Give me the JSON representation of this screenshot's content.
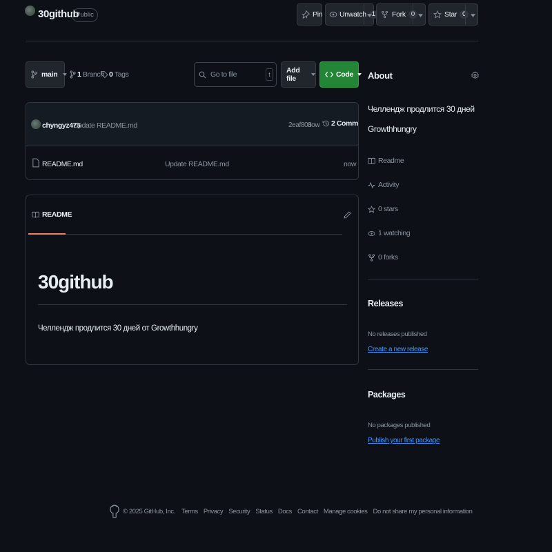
{
  "repo": {
    "name": "30github",
    "visibility": "Public"
  },
  "actions": {
    "pin_label": "Pin",
    "unwatch_label": "Unwatch",
    "unwatch_count": "1",
    "fork_label": "Fork",
    "fork_count": "0",
    "star_label": "Star",
    "star_count": "0"
  },
  "toolbar": {
    "branch": "main",
    "branches_count": "1",
    "branches_label": "Branch",
    "tags_count": "0",
    "tags_label": "Tags",
    "search_placeholder": "Go to file",
    "search_shortcut": "t",
    "add_file_label": "Add file",
    "code_label": "Code"
  },
  "latest_commit": {
    "author": "chyngyz475",
    "message": "Update README.md",
    "hash": "2eaf803",
    "time": "now",
    "commits_count": "2",
    "commits_label": "Commits"
  },
  "files": [
    {
      "name": "README.md",
      "message": "Update README.md",
      "time": "now"
    }
  ],
  "readme": {
    "tab_label": "README",
    "heading": "30github",
    "body": "Челлендж продлится 30 дней от Growthhungry"
  },
  "about": {
    "title": "About",
    "description_line1": "Челлендж продлится 30 дней",
    "description_line2": "Growthhungry",
    "stats": [
      {
        "icon": "book-icon",
        "label": "Readme"
      },
      {
        "icon": "pulse-icon",
        "label": "Activity"
      },
      {
        "icon": "star-icon",
        "label": "0 stars"
      },
      {
        "icon": "eye-icon",
        "label": "1 watching"
      },
      {
        "icon": "fork-icon",
        "label": "0 forks"
      }
    ]
  },
  "releases": {
    "title": "Releases",
    "empty_text": "No releases published",
    "link": "Create a new release"
  },
  "packages": {
    "title": "Packages",
    "empty_text": "No packages published",
    "link": "Publish your first package"
  },
  "footer": {
    "copyright": "© 2025 GitHub, Inc.",
    "links": [
      "Terms",
      "Privacy",
      "Security",
      "Status",
      "Docs",
      "Contact",
      "Manage cookies",
      "Do not share my personal information"
    ]
  },
  "colors": {
    "background": "#0d1117",
    "accent_green": "#238636",
    "link_blue": "#4493f8",
    "readme_tab_underline": "#f78166"
  }
}
